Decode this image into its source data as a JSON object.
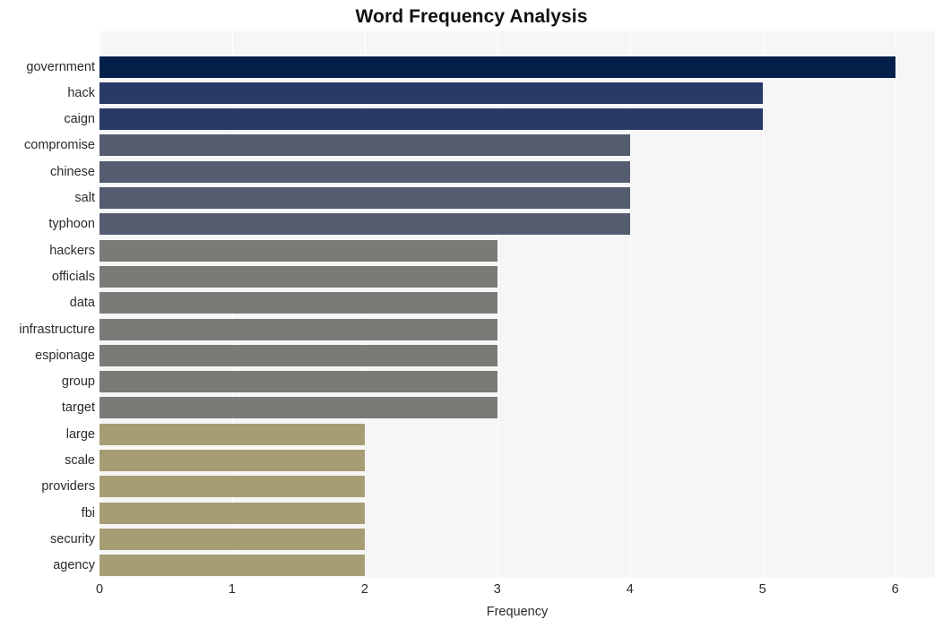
{
  "chart_data": {
    "type": "bar",
    "orientation": "horizontal",
    "title": "Word Frequency Analysis",
    "xlabel": "Frequency",
    "ylabel": "",
    "xlim": [
      0,
      6.3
    ],
    "xticks": [
      "0",
      "1",
      "2",
      "3",
      "4",
      "5",
      "6"
    ],
    "xtick_values": [
      0,
      1,
      2,
      3,
      4,
      5,
      6
    ],
    "grid": "vertical-white-on-gray",
    "legend": "none",
    "categories": [
      "government",
      "hack",
      "caign",
      "compromise",
      "chinese",
      "salt",
      "typhoon",
      "hackers",
      "officials",
      "data",
      "infrastructure",
      "espionage",
      "group",
      "target",
      "large",
      "scale",
      "providers",
      "fbi",
      "security",
      "agency"
    ],
    "values": [
      6,
      5,
      5,
      4,
      4,
      4,
      4,
      3,
      3,
      3,
      3,
      3,
      3,
      3,
      2,
      2,
      2,
      2,
      2,
      2
    ],
    "bar_colors": [
      "#04204a",
      "#2a3a68",
      "#2a3a68",
      "#565c70",
      "#565c70",
      "#565c70",
      "#565c70",
      "#7b7a77",
      "#7b7a77",
      "#7b7a77",
      "#7b7a77",
      "#7b7a77",
      "#7b7a77",
      "#7b7a77",
      "#a79d74",
      "#a79d74",
      "#a79d74",
      "#a79d74",
      "#a79d74",
      "#a79d74"
    ]
  },
  "style": {
    "plot_background": "#f6f6f7",
    "figure_background": "#ffffff",
    "gridline_color": "#ffffff",
    "text_color": "#2b2b2b",
    "title_color": "#111111"
  }
}
